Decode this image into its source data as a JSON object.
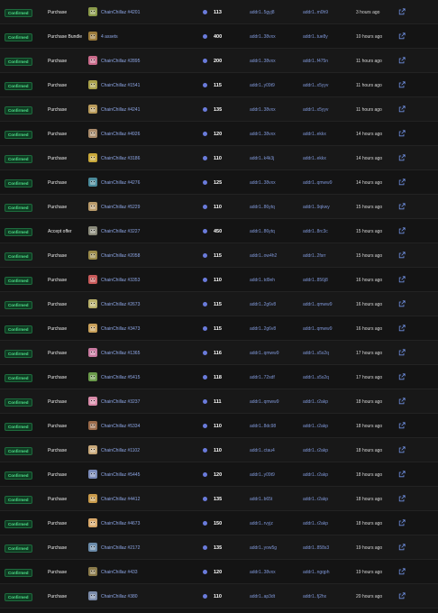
{
  "icons": {
    "thumbnail": "nft-thumbnail-icon",
    "currency": "ada-coin-icon",
    "external_link": "external-link-icon"
  },
  "colors": {
    "status_green": "#4ee08a",
    "link_blue": "#8fa8e8",
    "background": "#141414"
  },
  "rows": [
    {
      "status": "Confirmed",
      "type": "Purchase",
      "asset": "ChainChillaz #4201",
      "price": "113",
      "from": "addr1..5gyj8",
      "to": "addr1..m0h9",
      "time": "3 hours ago",
      "thumb": "#8a9a4a"
    },
    {
      "status": "Confirmed",
      "type": "Purchase Bundle",
      "asset": "4 assets",
      "price": "400",
      "from": "addr1..38vxx",
      "to": "addr1..tue8y",
      "time": "10 hours ago",
      "thumb": "#9a7a3a"
    },
    {
      "status": "Confirmed",
      "type": "Purchase",
      "asset": "ChainChillaz #2895",
      "price": "200",
      "from": "addr1..38vxx",
      "to": "addr1..f475n",
      "time": "11 hours ago",
      "thumb": "#c96a8a"
    },
    {
      "status": "Confirmed",
      "type": "Purchase",
      "asset": "ChainChillaz #1541",
      "price": "115",
      "from": "addr1..y09t9",
      "to": "addr1..x5yyv",
      "time": "11 hours ago",
      "thumb": "#a8a04a"
    },
    {
      "status": "Confirmed",
      "type": "Purchase",
      "asset": "ChainChillaz #4241",
      "price": "135",
      "from": "addr1..38vxx",
      "to": "addr1..x5yyv",
      "time": "11 hours ago",
      "thumb": "#b89a5a"
    },
    {
      "status": "Confirmed",
      "type": "Purchase",
      "asset": "ChainChillaz #4926",
      "price": "120",
      "from": "addr1..38vxx",
      "to": "addr1..ekkx",
      "time": "14 hours ago",
      "thumb": "#a88a6a"
    },
    {
      "status": "Confirmed",
      "type": "Purchase",
      "asset": "ChainChillaz #3186",
      "price": "110",
      "from": "addr1..k4k3j",
      "to": "addr1..ekkx",
      "time": "14 hours ago",
      "thumb": "#c8a83a"
    },
    {
      "status": "Confirmed",
      "type": "Purchase",
      "asset": "ChainChillaz #4276",
      "price": "125",
      "from": "addr1..38vxx",
      "to": "addr1..qmww9",
      "time": "14 hours ago",
      "thumb": "#4a8a9a"
    },
    {
      "status": "Confirmed",
      "type": "Purchase",
      "asset": "ChainChillaz #5229",
      "price": "110",
      "from": "addr1..86ytq",
      "to": "addr1..9qkwy",
      "time": "15 hours ago",
      "thumb": "#b89a6a"
    },
    {
      "status": "Confirmed",
      "type": "Accept offer",
      "asset": "ChainChillaz #3227",
      "price": "450",
      "from": "addr1..86ytq",
      "to": "addr1..8rc3c",
      "time": "15 hours ago",
      "thumb": "#8a8a7a"
    },
    {
      "status": "Confirmed",
      "type": "Purchase",
      "asset": "ChainChillaz #2058",
      "price": "115",
      "from": "addr1..ow4h2",
      "to": "addr1..2fsrr",
      "time": "15 hours ago",
      "thumb": "#9a8a4a"
    },
    {
      "status": "Confirmed",
      "type": "Purchase",
      "asset": "ChainChillaz #3353",
      "price": "110",
      "from": "addr1..td9eh",
      "to": "addr1..856j8",
      "time": "16 hours ago",
      "thumb": "#c85a5a"
    },
    {
      "status": "Confirmed",
      "type": "Purchase",
      "asset": "ChainChillaz #2673",
      "price": "115",
      "from": "addr1..2g6v8",
      "to": "addr1..qmww9",
      "time": "16 hours ago",
      "thumb": "#b8b06a"
    },
    {
      "status": "Confirmed",
      "type": "Purchase",
      "asset": "ChainChillaz #3473",
      "price": "115",
      "from": "addr1..2g6v8",
      "to": "addr1..qmww9",
      "time": "16 hours ago",
      "thumb": "#c8a05a"
    },
    {
      "status": "Confirmed",
      "type": "Purchase",
      "asset": "ChainChillaz #1365",
      "price": "116",
      "from": "addr1..qmww9",
      "to": "addr1..s5s2q",
      "time": "17 hours ago",
      "thumb": "#c87aa0"
    },
    {
      "status": "Confirmed",
      "type": "Purchase",
      "asset": "ChainChillaz #5415",
      "price": "118",
      "from": "addr1..72sdf",
      "to": "addr1..s5s2q",
      "time": "17 hours ago",
      "thumb": "#6a9a4a"
    },
    {
      "status": "Confirmed",
      "type": "Purchase",
      "asset": "ChainChillaz #3237",
      "price": "111",
      "from": "addr1..qmww9",
      "to": "addr1..r2akp",
      "time": "18 hours ago",
      "thumb": "#d88aa8"
    },
    {
      "status": "Confirmed",
      "type": "Purchase",
      "asset": "ChainChillaz #5334",
      "price": "110",
      "from": "addr1..8dc98",
      "to": "addr1..r2akp",
      "time": "18 hours ago",
      "thumb": "#9a6a4a"
    },
    {
      "status": "Confirmed",
      "type": "Purchase",
      "asset": "ChainChillaz #1102",
      "price": "110",
      "from": "addr1..ctau4",
      "to": "addr1..r2akp",
      "time": "18 hours ago",
      "thumb": "#c8a87a"
    },
    {
      "status": "Confirmed",
      "type": "Purchase",
      "asset": "ChainChillaz #5445",
      "price": "120",
      "from": "addr1..y09t9",
      "to": "addr1..r2akp",
      "time": "18 hours ago",
      "thumb": "#7a8ab8"
    },
    {
      "status": "Confirmed",
      "type": "Purchase",
      "asset": "ChainChillaz #4412",
      "price": "135",
      "from": "addr1..b65t",
      "to": "addr1..r2akp",
      "time": "18 hours ago",
      "thumb": "#c89a4a"
    },
    {
      "status": "Confirmed",
      "type": "Purchase",
      "asset": "ChainChillaz #4673",
      "price": "150",
      "from": "addr1..rvyjz",
      "to": "addr1..r2akp",
      "time": "18 hours ago",
      "thumb": "#d8a86a"
    },
    {
      "status": "Confirmed",
      "type": "Purchase",
      "asset": "ChainChillaz #2172",
      "price": "135",
      "from": "addr1..yow5g",
      "to": "addr1..858s3",
      "time": "19 hours ago",
      "thumb": "#6a8aa8"
    },
    {
      "status": "Confirmed",
      "type": "Purchase",
      "asset": "ChainChillaz #433",
      "price": "120",
      "from": "addr1..38vxx",
      "to": "addr1..ngqph",
      "time": "19 hours ago",
      "thumb": "#8a7a4a"
    },
    {
      "status": "Confirmed",
      "type": "Purchase",
      "asset": "ChainChillaz #380",
      "price": "110",
      "from": "addr1..ap3dt",
      "to": "addr1..fj2hx",
      "time": "20 hours ago",
      "thumb": "#7a8aa8"
    }
  ]
}
